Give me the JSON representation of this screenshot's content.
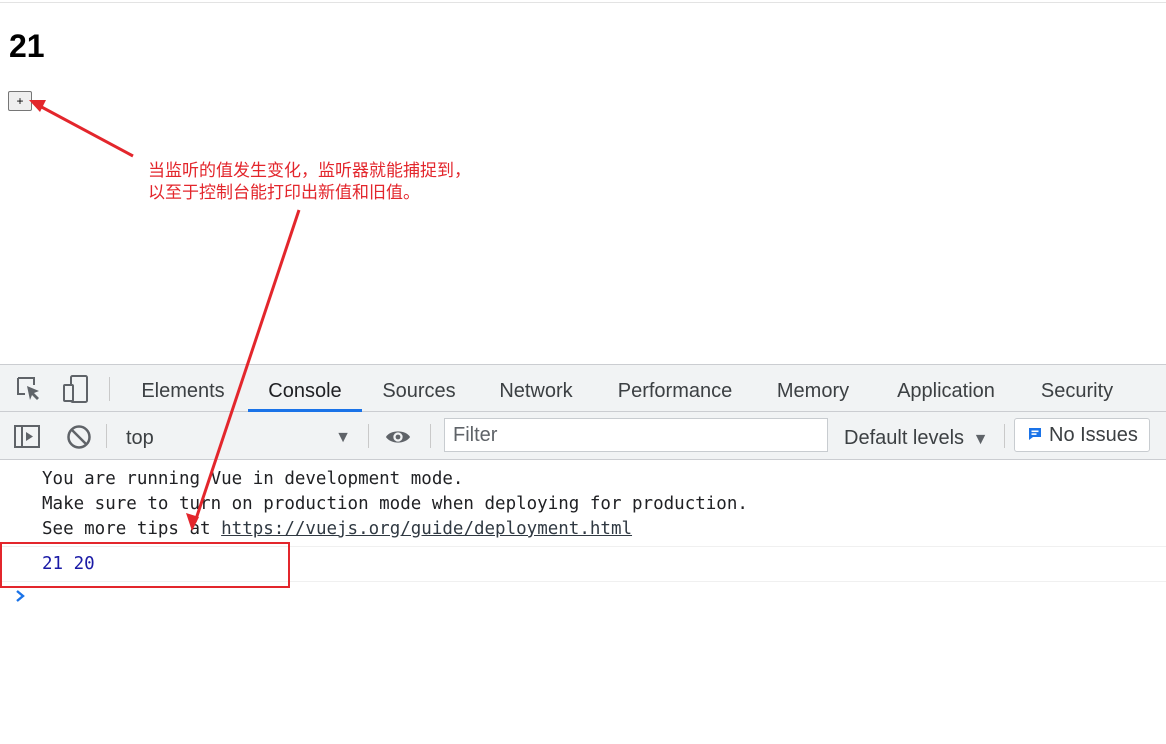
{
  "page": {
    "counter_value": "21",
    "increment_button_label": "+"
  },
  "annotation": {
    "line1": "当监听的值发生变化，监听器就能捕捉到，",
    "line2": "以至于控制台能打印出新值和旧值。",
    "color": "#e3262c"
  },
  "devtools": {
    "tabs": [
      {
        "label": "Elements"
      },
      {
        "label": "Console"
      },
      {
        "label": "Sources"
      },
      {
        "label": "Network"
      },
      {
        "label": "Performance"
      },
      {
        "label": "Memory"
      },
      {
        "label": "Application"
      },
      {
        "label": "Security"
      }
    ],
    "active_tab": "Console",
    "accent_color": "#1a73e8",
    "toolbar": {
      "icons": [
        "inspect-element-icon",
        "device-toolbar-icon"
      ]
    },
    "console_bar": {
      "icons": [
        "sidebar-toggle-icon",
        "clear-console-icon",
        "live-expression-eye-icon"
      ],
      "context": "top",
      "filter_placeholder": "Filter",
      "levels": "Default levels",
      "issues": "No Issues"
    },
    "messages": {
      "line1": "You are running Vue in development mode.",
      "line2": "Make sure to turn on production mode when deploying for production.",
      "line3_prefix": "See more tips at ",
      "line3_link": "https://vuejs.org/guide/deployment.html",
      "watch_output": "21 20"
    }
  }
}
